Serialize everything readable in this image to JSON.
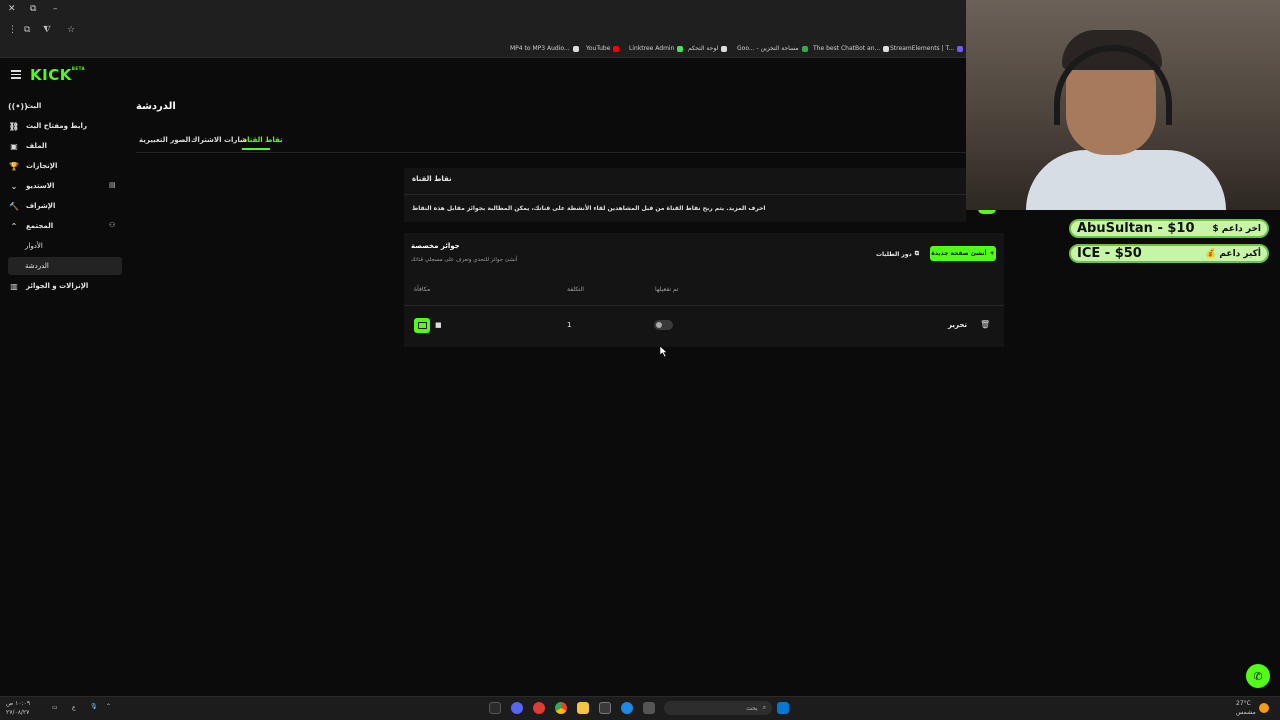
{
  "browser": {
    "window_controls": [
      "✕",
      "⧉",
      "–"
    ],
    "bookmarks": [
      {
        "label": "MP4 to MP3 Audio...",
        "color": "#ffffff"
      },
      {
        "label": "YouTube",
        "color": "#ff0000"
      },
      {
        "label": "Linktree Admin",
        "color": "#43e55e"
      },
      {
        "label": "لوحة التحكم",
        "color": "#ffffff"
      },
      {
        "label": "Goo... - مساحة التخزين",
        "color": "#34a853"
      },
      {
        "label": "The best ChatBot an...",
        "color": "#ffffff"
      },
      {
        "label": "StreamElements | T...",
        "color": "#6e5cff"
      }
    ]
  },
  "kick": {
    "logo": "KICK",
    "logo_beta": "BETA"
  },
  "sidebar": {
    "items": [
      {
        "label": "البث",
        "icon": "((•))"
      },
      {
        "label": "رابط ومفتاح البث",
        "icon": "⛓"
      },
      {
        "label": "الملف",
        "icon": "▣"
      },
      {
        "label": "الإنجازات",
        "icon": "🏆"
      },
      {
        "label": "الاستديو",
        "icon": "⌄"
      },
      {
        "label": "الإشراف",
        "icon": "🔨"
      },
      {
        "label": "المجتمع",
        "icon": "⌃"
      },
      {
        "label": "الأدوار",
        "icon": ""
      },
      {
        "label": "الدردشة",
        "icon": ""
      },
      {
        "label": "الإنزالات و الجوائز",
        "icon": "▥"
      }
    ]
  },
  "main": {
    "page_title": "الدردشة",
    "tabs": [
      "نقاط القناة",
      "شارات الاشتراك",
      "الصور التعبيرية"
    ],
    "channel_points": {
      "title": "نقاط القناة",
      "description": "احرف المزيد. يتم ربح نقاط القناة من قبل المشاهدين لقاء الأنشطة على قناتك، يمكن المطالبة بجوائز مقابل هذه النقاط"
    },
    "custom_rewards": {
      "title": "جوائز مخصصة",
      "subtitle": "أنشئ جوائز للتحدي وتعرف على مسجلي قناتك",
      "history_label": "دور الطلبات",
      "add_label": "أنشئ صفحة جديدة",
      "columns": [
        "مكافأة",
        "التكلفة",
        "تم تفعيلها"
      ],
      "rows": [
        {
          "name": "■",
          "cost": "1",
          "edit_label": "تحرير",
          "enabled": 0
        }
      ]
    }
  },
  "overlay": {
    "supporters": [
      {
        "name": "AbuSultan - $10",
        "label": "$ اخر داعم"
      },
      {
        "name": "ICE - $50",
        "label": "💰 أكبر داعم"
      }
    ]
  },
  "taskbar": {
    "search_placeholder": "بحث",
    "time": "١٠:٠٩ ص",
    "date": "٢٧/٠٨/٢٧",
    "weather_temp": "27°C",
    "weather_desc": "مشمس",
    "lang": "ع"
  }
}
